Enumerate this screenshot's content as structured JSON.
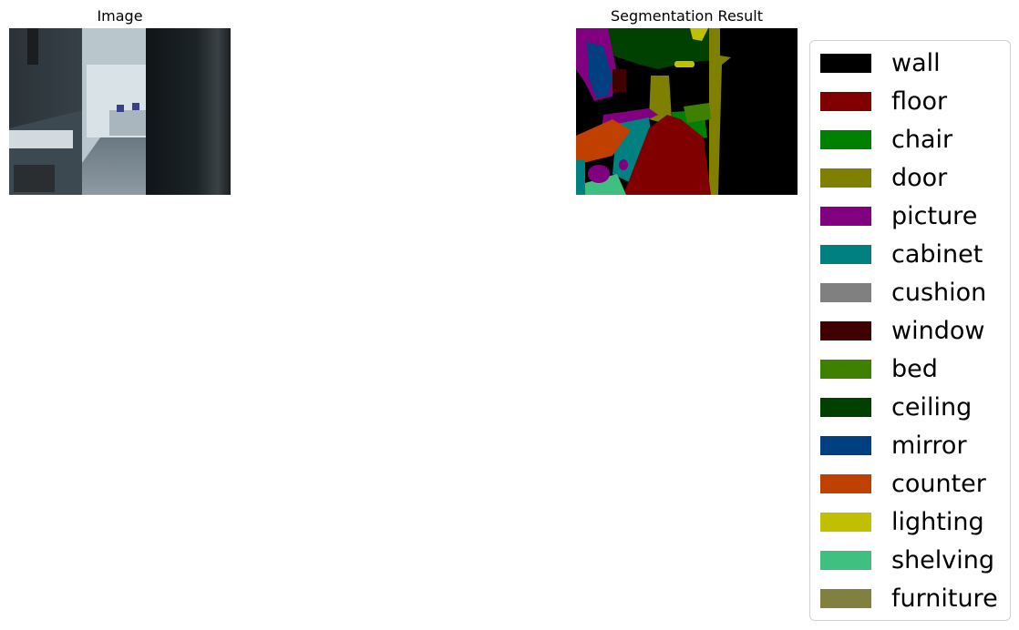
{
  "left_panel": {
    "title": "Image"
  },
  "right_panel": {
    "title": "Segmentation Result"
  },
  "legend": {
    "items": [
      {
        "label": "wall",
        "color": "#000000"
      },
      {
        "label": "floor",
        "color": "#800000"
      },
      {
        "label": "chair",
        "color": "#008000"
      },
      {
        "label": "door",
        "color": "#808000"
      },
      {
        "label": "picture",
        "color": "#800080"
      },
      {
        "label": "cabinet",
        "color": "#008080"
      },
      {
        "label": "cushion",
        "color": "#808080"
      },
      {
        "label": "window",
        "color": "#400000"
      },
      {
        "label": "bed",
        "color": "#408000"
      },
      {
        "label": "ceiling",
        "color": "#004000"
      },
      {
        "label": "mirror",
        "color": "#004080"
      },
      {
        "label": "counter",
        "color": "#c04000"
      },
      {
        "label": "lighting",
        "color": "#c0c000"
      },
      {
        "label": "shelving",
        "color": "#40c080"
      },
      {
        "label": "furniture",
        "color": "#808040"
      }
    ]
  }
}
